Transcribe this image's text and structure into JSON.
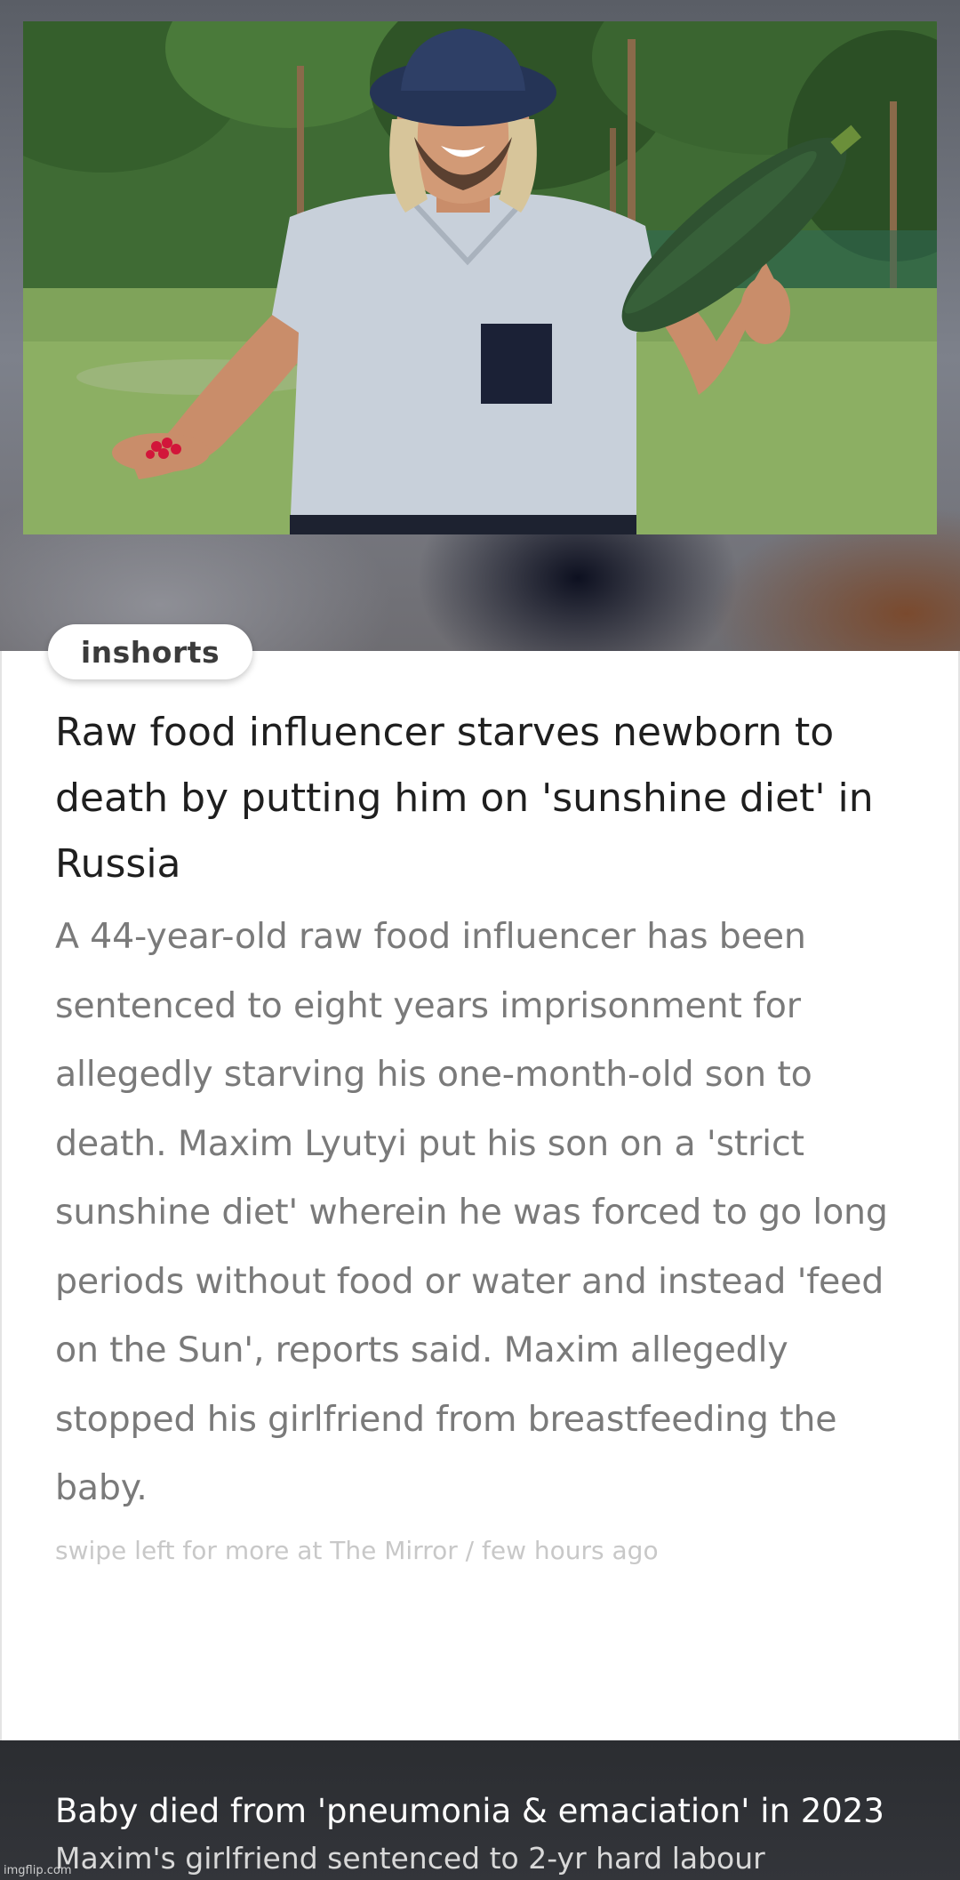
{
  "card": {
    "brand": "inshorts",
    "headline": "Raw food influencer starves newborn to death by putting him on 'sunshine diet' in Russia",
    "body": "A 44-year-old raw food influencer has been sentenced to eight years imprisonment for allegedly starving his one-month-old son to death. Maxim Lyutyi put his son on a 'strict sunshine diet' wherein he was forced to go long periods without food or water and instead 'feed on the Sun', reports said. Maxim allegedly stopped his girlfriend from breastfeeding the baby.",
    "source_prefix": "swipe left for more at ",
    "source_name": "The Mirror",
    "source_sep": " / ",
    "timestamp": "few hours ago"
  },
  "footer": {
    "title": "Baby died from 'pneumonia & emaciation' in 2023",
    "subtitle": "Maxim's girlfriend sentenced to 2-yr hard labour"
  },
  "watermark": "imgflip.com",
  "colors": {
    "headline": "#1f1f1f",
    "body": "#7a7a7a",
    "source": "#c8c8c8",
    "footer_bg": "#2b2d31"
  }
}
